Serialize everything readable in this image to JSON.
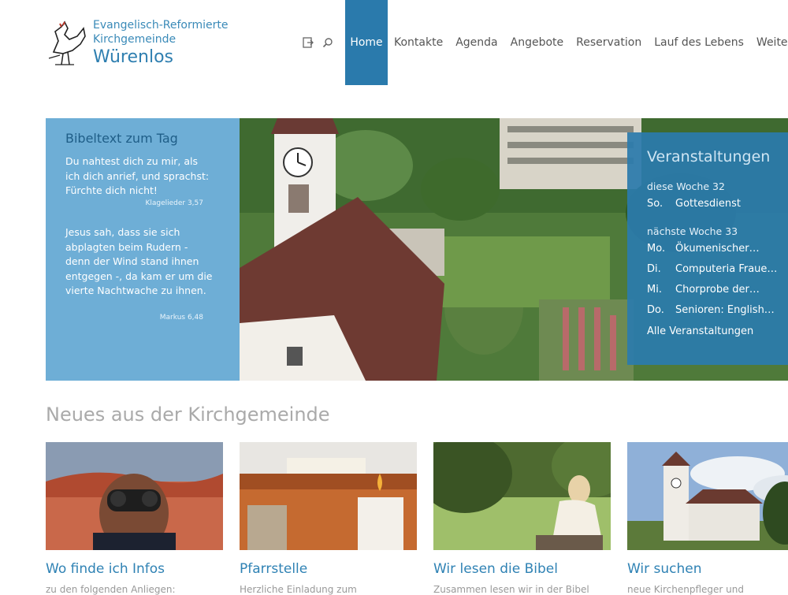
{
  "header": {
    "org_line1": "Evangelisch-Reformierte",
    "org_line2": "Kirchgemeinde",
    "org_line3": "Würenlos",
    "nav": [
      "Home",
      "Kontakte",
      "Agenda",
      "Angebote",
      "Reservation",
      "Lauf des Lebens",
      "Weitere Di"
    ],
    "icons": [
      "login-icon",
      "search-icon"
    ]
  },
  "bible": {
    "title": "Bibeltext zum Tag",
    "verse1": "Du nahtest dich zu mir, als ich dich anrief, und sprachst: Fürchte dich nicht!",
    "ref1": "Klagelieder 3,57",
    "verse2": "Jesus sah, dass sie sich abplagten beim Rudern - denn der Wind stand ihnen entgegen -, da kam er um die vierte Nachtwache zu ihnen.",
    "ref2": "Markus 6,48"
  },
  "events": {
    "title": "Veranstaltungen",
    "week1": "diese Woche 32",
    "week1_items": [
      {
        "day": "So.",
        "name": "Gottesdienst"
      }
    ],
    "week2": "nächste Woche 33",
    "week2_items": [
      {
        "day": "Mo.",
        "name": "Ökumenischer…"
      },
      {
        "day": "Di.",
        "name": "Computeria Fraue…"
      },
      {
        "day": "Mi.",
        "name": "Chorprobe der…"
      },
      {
        "day": "Do.",
        "name": "Senioren: English…"
      }
    ],
    "all_link": "Alle Veranstaltungen"
  },
  "news": {
    "heading": "Neues aus der Kirchgemeinde",
    "cards": [
      {
        "title": "Wo finde ich Infos",
        "sub": "zu den folgenden Anliegen:"
      },
      {
        "title": "Pfarrstelle",
        "sub": "Herzliche Einladung zum"
      },
      {
        "title": "Wir lesen die Bibel",
        "sub": "Zusammen lesen wir in der Bibel"
      },
      {
        "title": "Wir suchen",
        "sub": "neue Kirchenpfleger und"
      }
    ]
  },
  "colors": {
    "accent": "#2a7aac",
    "bible_bg": "#6eaed6",
    "events_bg": "#2b7bac"
  }
}
